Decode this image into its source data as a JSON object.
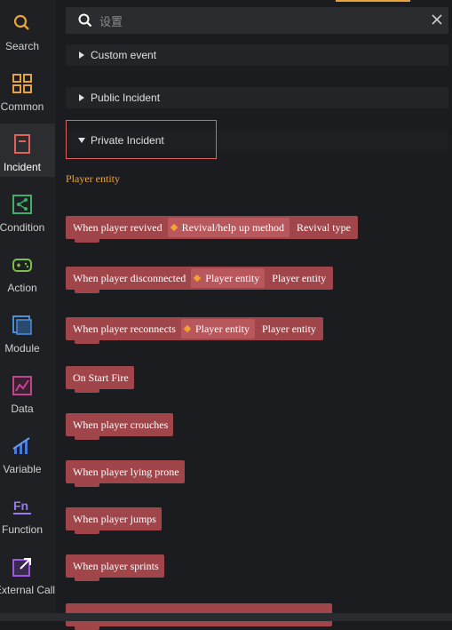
{
  "sidebar": {
    "items": [
      {
        "label": "Search",
        "icon": "search-icon",
        "color": "#e8a33c"
      },
      {
        "label": "Common",
        "icon": "grid-icon",
        "color": "#e8a33c"
      },
      {
        "label": "Incident",
        "icon": "incident-icon",
        "color": "#e0605a",
        "active": true
      },
      {
        "label": "Condition",
        "icon": "condition-icon",
        "color": "#3fae6a"
      },
      {
        "label": "Action",
        "icon": "gamepad-icon",
        "color": "#7cc04a"
      },
      {
        "label": "Module",
        "icon": "module-icon",
        "color": "#4a90d9"
      },
      {
        "label": "Data",
        "icon": "data-icon",
        "color": "#c0458a"
      },
      {
        "label": "Variable",
        "icon": "variable-icon",
        "color": "#4a7ad9"
      },
      {
        "label": "Function",
        "icon": "function-icon",
        "color": "#7a5ad9"
      },
      {
        "label": "External Call",
        "icon": "external-call-icon",
        "color": "#9a5ad9"
      }
    ]
  },
  "search": {
    "placeholder": "设置"
  },
  "sections": {
    "custom": "Custom event",
    "public": "Public Incident",
    "private": "Private Incident"
  },
  "category": "Player entity",
  "blocks": [
    {
      "text": "When player revived",
      "param": "Revival/help up method",
      "tail": "Revival type"
    },
    {
      "text": "When player disconnected",
      "param": "Player entity",
      "tail": "Player entity"
    },
    {
      "text": "When player reconnects",
      "param": "Player entity",
      "tail": "Player entity"
    },
    {
      "text": "On Start Fire"
    },
    {
      "text": "When player crouches"
    },
    {
      "text": "When player lying prone"
    },
    {
      "text": "When player jumps"
    },
    {
      "text": "When player sprints"
    }
  ],
  "colors": {
    "accent": "#e8a33c",
    "block": "#a0454a",
    "highlight": "#e0605a"
  }
}
